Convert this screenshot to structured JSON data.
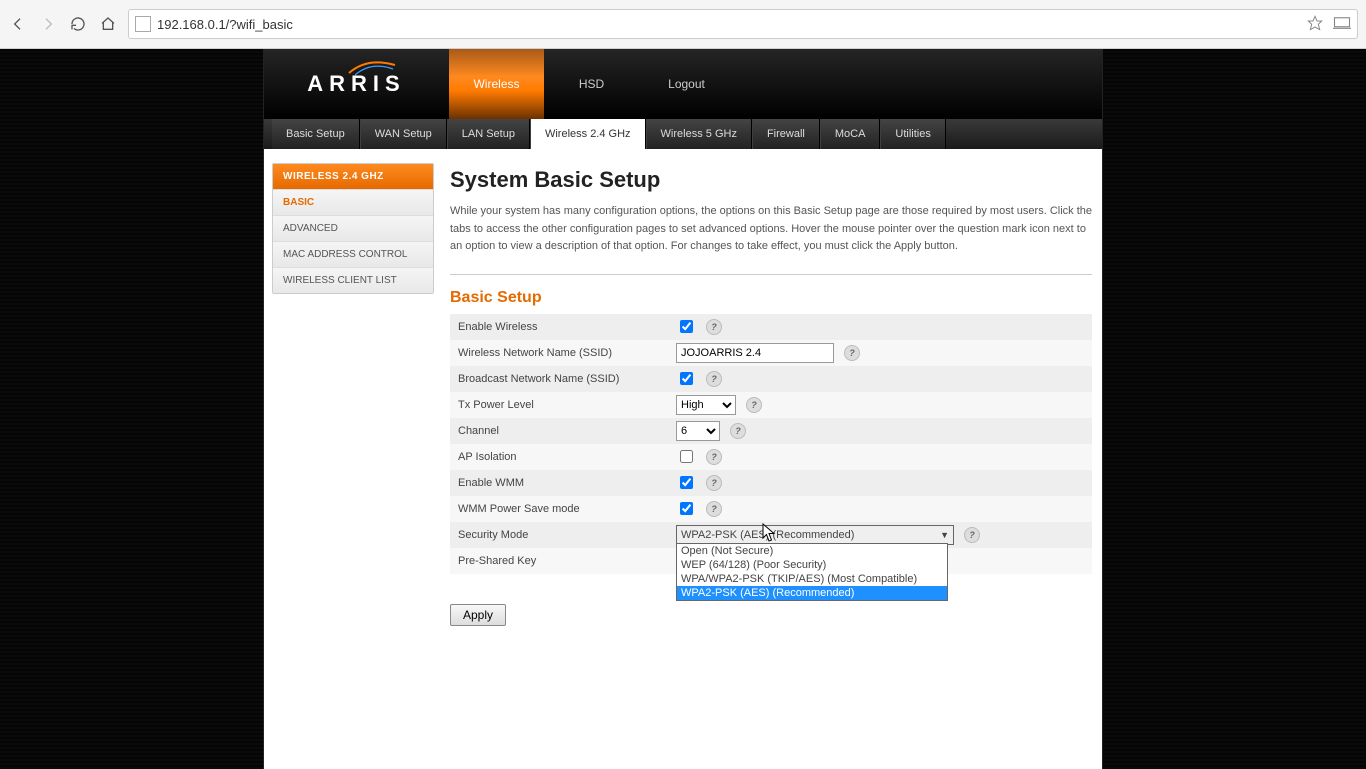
{
  "browser": {
    "url": "192.168.0.1/?wifi_basic"
  },
  "brand": "ARRIS",
  "topnav": {
    "wireless": "Wireless",
    "hsd": "HSD",
    "logout": "Logout"
  },
  "tabs": {
    "basic_setup": "Basic Setup",
    "wan_setup": "WAN Setup",
    "lan_setup": "LAN Setup",
    "wireless_24": "Wireless 2.4 GHz",
    "wireless_5": "Wireless 5 GHz",
    "firewall": "Firewall",
    "moca": "MoCA",
    "utilities": "Utilities"
  },
  "sidebar": {
    "header": "WIRELESS 2.4 GHZ",
    "basic": "BASIC",
    "advanced": "ADVANCED",
    "mac": "MAC ADDRESS CONTROL",
    "clients": "WIRELESS CLIENT LIST"
  },
  "page": {
    "title": "System Basic Setup",
    "intro": "While your system has many configuration options, the options on this Basic Setup page are those required by most users. Click the tabs to access the other configuration pages to set advanced options. Hover the mouse pointer over the question mark icon next to an option to view a description of that option. For changes to take effect, you must click the Apply button.",
    "section": "Basic Setup"
  },
  "form": {
    "enable_wireless": {
      "label": "Enable Wireless",
      "checked": true
    },
    "ssid": {
      "label": "Wireless Network Name (SSID)",
      "value": "JOJOARRIS 2.4"
    },
    "broadcast": {
      "label": "Broadcast Network Name (SSID)",
      "checked": true
    },
    "tx_power": {
      "label": "Tx Power Level",
      "value": "High"
    },
    "channel": {
      "label": "Channel",
      "value": "6"
    },
    "ap_isolation": {
      "label": "AP Isolation",
      "checked": false
    },
    "enable_wmm": {
      "label": "Enable WMM",
      "checked": true
    },
    "wmm_ps": {
      "label": "WMM Power Save mode",
      "checked": true
    },
    "security": {
      "label": "Security Mode",
      "value": "WPA2-PSK (AES) (Recommended)",
      "options": {
        "open": "Open (Not Secure)",
        "wep": "WEP (64/128) (Poor Security)",
        "wpa": "WPA/WPA2-PSK (TKIP/AES) (Most Compatible)",
        "wpa2": "WPA2-PSK (AES) (Recommended)"
      }
    },
    "psk": {
      "label": "Pre-Shared Key"
    }
  },
  "apply": "Apply",
  "help_glyph": "?"
}
